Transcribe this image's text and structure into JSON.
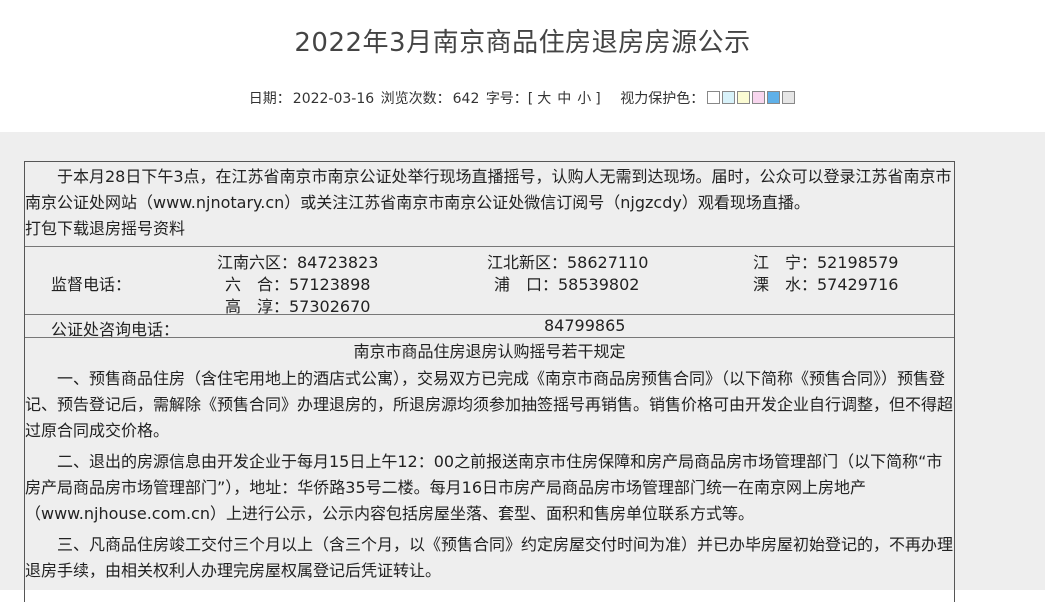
{
  "page": {
    "title": "2022年3月南京商品住房退房房源公示",
    "meta": {
      "date_label": "日期：",
      "date_value": "2022-03-16",
      "views_label": "浏览次数：",
      "views_value": "642",
      "font_label": "字号：[",
      "font_large": "大",
      "font_medium": "中",
      "font_small": "小",
      "font_close": "]",
      "eye_label": "视力保护色："
    },
    "swatches": [
      "#ffffff",
      "#d8f2fa",
      "#fbfbd3",
      "#f8d6ee",
      "#5fb0e8",
      "#e6e6e6"
    ]
  },
  "intro": {
    "text": "于本月28日下午3点，在江苏省南京市南京公证处举行现场直播摇号，认购人无需到达现场。届时，公众可以登录江苏省南京市南京公证处网站（www.njnotary.cn）或关注江苏省南京市南京公证处微信订阅号（njgzcdy）观看现场直播。",
    "download": "打包下载退房摇号资料"
  },
  "phones": {
    "label": "监督电话：",
    "entries": [
      "江南六区：84723823",
      "江北新区：58627110",
      "江　宁：52198579",
      "六　合：57123898",
      "浦　口：58539802",
      "溧　水：57429716",
      "高　淳：57302670"
    ]
  },
  "consult": {
    "label": "公证处咨询电话：",
    "number": "84799865"
  },
  "rules": {
    "title": "南京市商品住房退房认购摇号若干规定",
    "items": [
      "一、预售商品住房（含住宅用地上的酒店式公寓），交易双方已完成《南京市商品房预售合同》（以下简称《预售合同》）预售登记、预告登记后，需解除《预售合同》办理退房的，所退房源均须参加抽签摇号再销售。销售价格可由开发企业自行调整，但不得超过原合同成交价格。",
      "二、退出的房源信息由开发企业于每月15日上午12：00之前报送南京市住房保障和房产局商品房市场管理部门（以下简称“市房产局商品房市场管理部门”），地址：华侨路35号二楼。每月16日市房产局商品房市场管理部门统一在南京网上房地产（www.njhouse.com.cn）上进行公示，公示内容包括房屋坐落、套型、面积和售房单位联系方式等。",
      "三、凡商品住房竣工交付三个月以上（含三个月，以《预售合同》约定房屋交付时间为准）并已办毕房屋初始登记的，不再办理退房手续，由相关权利人办理完房屋权属登记后凭证转让。"
    ]
  }
}
